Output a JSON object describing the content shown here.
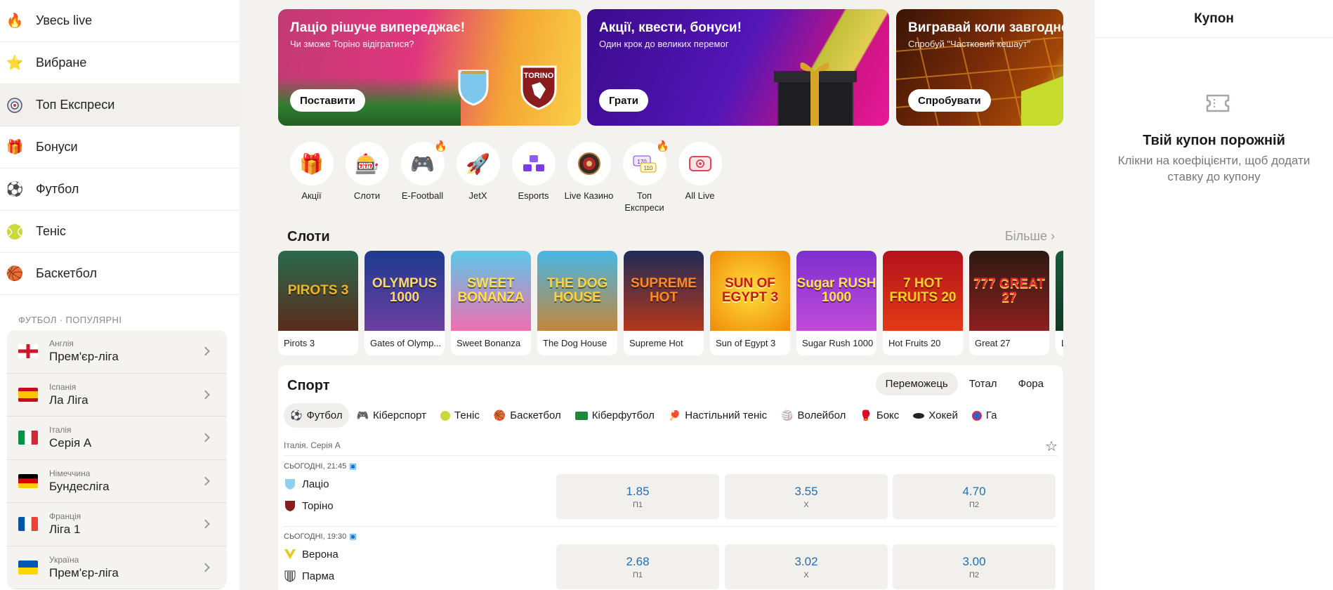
{
  "sidebar": {
    "items": [
      {
        "label": "Увесь live",
        "icon": "fire-icon"
      },
      {
        "label": "Вибране",
        "icon": "star-icon"
      },
      {
        "label": "Топ Експреси",
        "icon": "target-icon"
      },
      {
        "label": "Бонуси",
        "icon": "gift-icon"
      },
      {
        "label": "Футбол",
        "icon": "soccer-ball-icon"
      },
      {
        "label": "Теніс",
        "icon": "tennis-ball-icon"
      },
      {
        "label": "Баскетбол",
        "icon": "basketball-icon"
      }
    ],
    "section_title": "ФУТБОЛ · ПОПУЛЯРНІ",
    "leagues": [
      {
        "country": "Англія",
        "name": "Прем'єр-ліга"
      },
      {
        "country": "Іспанія",
        "name": "Ла Ліга"
      },
      {
        "country": "Італія",
        "name": "Серія А"
      },
      {
        "country": "Німеччина",
        "name": "Бундесліга"
      },
      {
        "country": "Франція",
        "name": "Ліга 1"
      },
      {
        "country": "Україна",
        "name": "Прем'єр-ліга"
      }
    ]
  },
  "banners": [
    {
      "title": "Лаціо рішуче випереджає!",
      "subtitle": "Чи зможе Торіно відігратися?",
      "button": "Поставити",
      "badge_right": "TORINO"
    },
    {
      "title": "Акції, квести, бонуси!",
      "subtitle": "Один крок до великих перемог",
      "button": "Грати"
    },
    {
      "title": "Вигравай коли завгодно!",
      "subtitle": "Спробуй \"Частковий кешаут\"",
      "button": "Спробувати"
    }
  ],
  "quick_links": [
    {
      "label": "Акції",
      "icon": "promo-box-icon",
      "hot": false
    },
    {
      "label": "Слоти",
      "icon": "slot-machine-icon",
      "hot": false
    },
    {
      "label": "E-Football",
      "icon": "gamepad-icon",
      "hot": true
    },
    {
      "label": "JetX",
      "icon": "jet-icon",
      "hot": false
    },
    {
      "label": "Esports",
      "icon": "esports-icon",
      "hot": false
    },
    {
      "label": "Live Казино",
      "icon": "roulette-icon",
      "hot": false
    },
    {
      "label": "Топ Експреси",
      "icon": "express-icon",
      "hot": true
    },
    {
      "label": "All Live",
      "icon": "live-tv-icon",
      "hot": false
    }
  ],
  "slots": {
    "title": "Слоти",
    "more": "Більше",
    "games": [
      {
        "name": "Pirots 3",
        "art": "PIROTS 3"
      },
      {
        "name": "Gates of Olymp...",
        "art": "OLYMPUS 1000"
      },
      {
        "name": "Sweet Bonanza",
        "art": "SWEET BONANZA"
      },
      {
        "name": "The Dog House",
        "art": "THE DOG HOUSE"
      },
      {
        "name": "Supreme Hot",
        "art": "SUPREME HOT"
      },
      {
        "name": "Sun of Egypt 3",
        "art": "SUN OF EGYPT 3"
      },
      {
        "name": "Sugar Rush 1000",
        "art": "Sugar RUSH 1000"
      },
      {
        "name": "Hot Fruits 20",
        "art": "7 HOT FRUITS 20"
      },
      {
        "name": "Great 27",
        "art": "777 GREAT 27"
      },
      {
        "name": "L",
        "art": ""
      }
    ]
  },
  "sport": {
    "title": "Спорт",
    "market_tabs": [
      "Переможець",
      "Тотал",
      "Фора"
    ],
    "sport_tabs": [
      {
        "label": "Футбол",
        "icon": "soccer-ball-icon"
      },
      {
        "label": "Кіберспорт",
        "icon": "gamepad-icon"
      },
      {
        "label": "Теніс",
        "icon": "tennis-ball-icon"
      },
      {
        "label": "Баскетбол",
        "icon": "basketball-icon"
      },
      {
        "label": "Кіберфутбол",
        "icon": "cyberfootball-icon"
      },
      {
        "label": "Настільний теніс",
        "icon": "ping-pong-icon"
      },
      {
        "label": "Волейбол",
        "icon": "volleyball-icon"
      },
      {
        "label": "Бокс",
        "icon": "boxing-glove-icon"
      },
      {
        "label": "Хокей",
        "icon": "hockey-puck-icon"
      },
      {
        "label": "Га",
        "icon": "handball-icon"
      }
    ],
    "league": "Італія. Серія А",
    "matches": [
      {
        "time": "СЬОГОДНІ, 21:45",
        "home": "Лаціо",
        "away": "Торіно",
        "odds": [
          {
            "value": "1.85",
            "label": "П1"
          },
          {
            "value": "3.55",
            "label": "Х"
          },
          {
            "value": "4.70",
            "label": "П2"
          }
        ]
      },
      {
        "time": "СЬОГОДНІ, 19:30",
        "home": "Верона",
        "away": "Парма",
        "odds": [
          {
            "value": "2.68",
            "label": "П1"
          },
          {
            "value": "3.02",
            "label": "Х"
          },
          {
            "value": "3.00",
            "label": "П2"
          }
        ]
      }
    ]
  },
  "coupon": {
    "title": "Купон",
    "empty_title": "Твій купон порожній",
    "empty_text": "Клікни на коефіцієнти, щоб додати ставку до купону"
  },
  "colors": {
    "accent": "#1f6fb8",
    "panel": "#f1f0ed"
  }
}
